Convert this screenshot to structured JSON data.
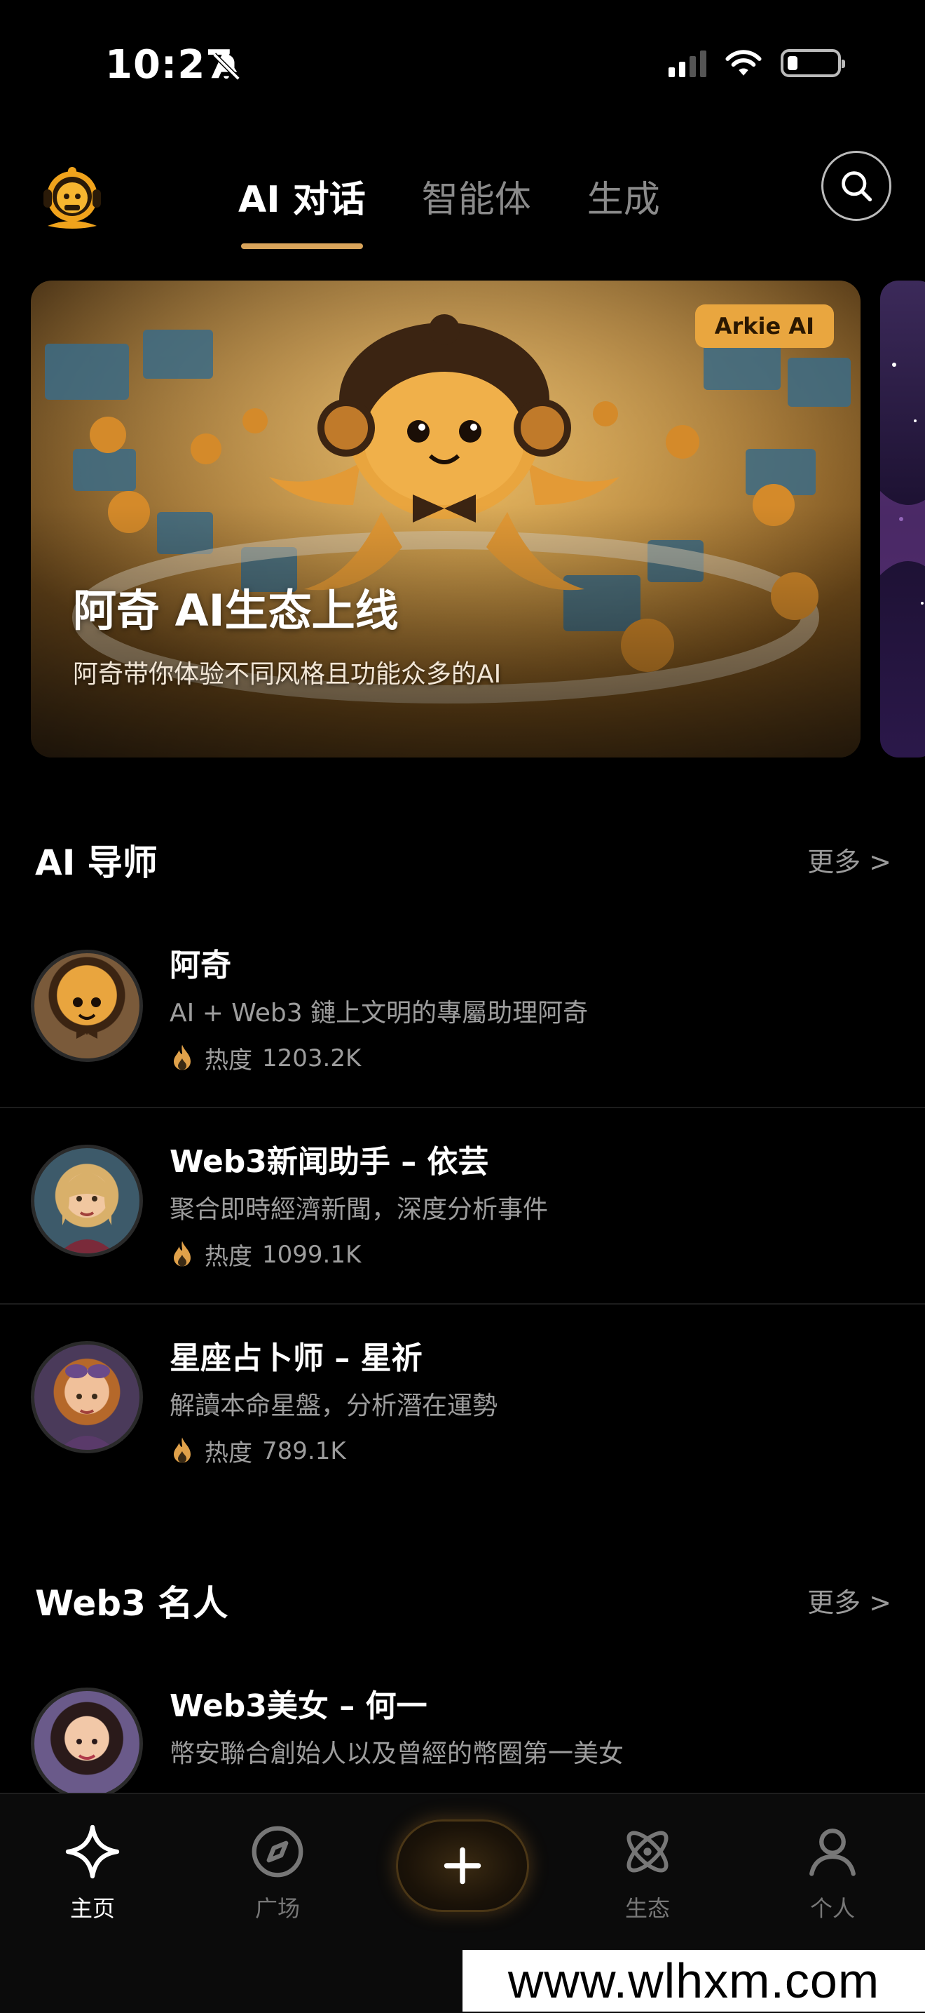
{
  "status_bar": {
    "time": "10:27",
    "icons": [
      "bell-muted-icon",
      "signal-icon",
      "wifi-icon",
      "battery-icon"
    ]
  },
  "header": {
    "tabs": [
      {
        "label": "AI 对话",
        "active": true
      },
      {
        "label": "智能体",
        "active": false
      },
      {
        "label": "生成",
        "active": false
      }
    ],
    "search_icon": "search-icon"
  },
  "banner": {
    "badge": "Arkie AI",
    "title": "阿奇 AI生态上线",
    "subtitle": "阿奇带你体验不同风格且功能众多的AI"
  },
  "sections": [
    {
      "title": "AI 导师",
      "more": "更多 >",
      "items": [
        {
          "name": "阿奇",
          "desc": "AI + Web3 鏈上文明的專屬助理阿奇",
          "heat_label": "热度",
          "heat_value": "1203.2K"
        },
        {
          "name": "Web3新闻助手 – 依芸",
          "desc": "聚合即時經濟新聞，深度分析事件",
          "heat_label": "热度",
          "heat_value": "1099.1K"
        },
        {
          "name": "星座占卜师 – 星祈",
          "desc": "解讀本命星盤，分析潛在運勢",
          "heat_label": "热度",
          "heat_value": "789.1K"
        }
      ]
    },
    {
      "title": "Web3 名人",
      "more": "更多 >",
      "items": [
        {
          "name": "Web3美女 – 何一",
          "desc": "幣安聯合創始人以及曾經的幣圈第一美女"
        }
      ]
    }
  ],
  "bottom_nav": [
    {
      "label": "主页",
      "icon": "sparkle-icon",
      "active": true
    },
    {
      "label": "广场",
      "icon": "compass-icon",
      "active": false
    },
    {
      "label": "",
      "icon": "plus-icon",
      "active": false
    },
    {
      "label": "生态",
      "icon": "atom-icon",
      "active": false
    },
    {
      "label": "个人",
      "icon": "person-icon",
      "active": false
    }
  ],
  "watermark": "www.wlhxm.com",
  "colors": {
    "accent": "#d9a45b",
    "badge": "#e9a63f",
    "background": "#000000"
  }
}
